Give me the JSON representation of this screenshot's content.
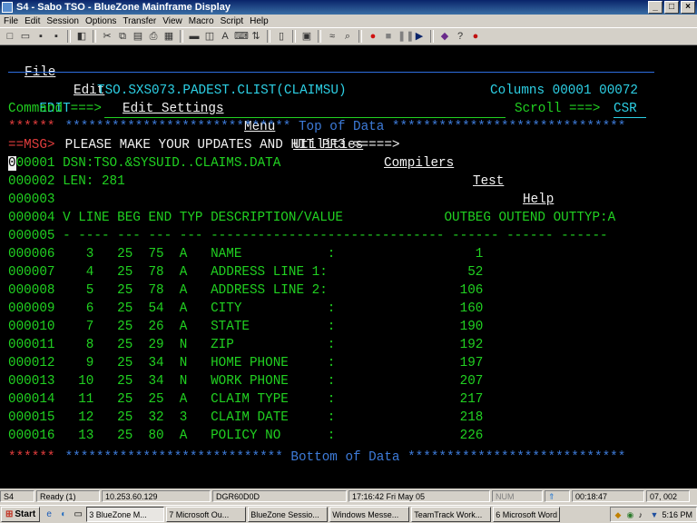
{
  "window": {
    "title": "S4 - Sabo TSO - BlueZone Mainframe Display"
  },
  "menu": [
    "File",
    "Edit",
    "Session",
    "Options",
    "Transfer",
    "View",
    "Macro",
    "Script",
    "Help"
  ],
  "ispf_menu": {
    "file": "File",
    "edit": "Edit",
    "edit_settings": "Edit_Settings",
    "menu": "Menu",
    "utilities": "Utilities",
    "compilers": "Compilers",
    "test": "Test",
    "help": "Help"
  },
  "header": {
    "mode": "EDIT",
    "dataset": "TSO.SXS073.PADEST.CLIST(CLAIMSU)",
    "columns": "Columns 00001 00072",
    "command_label": "Command ===>",
    "scroll_label": "Scroll ===>",
    "scroll_value": "CSR"
  },
  "editor": {
    "top_stars": "******",
    "top_marker": " ***************************** Top of Data ******************************",
    "msg_prefix": "==MSG>",
    "msg_text": " PLEASE MAKE YOUR UPDATES AND HIT PF3 =====>",
    "bottom_stars": "******",
    "bottom_marker": " **************************** Bottom of Data ****************************",
    "cursor_char": "0",
    "rows": [
      {
        "num": "00001",
        "text": " DSN:TSO.&SYSUID..CLAIMS.DATA"
      },
      {
        "num": "000002",
        "text": " LEN: 281"
      },
      {
        "num": "000003",
        "text": ""
      },
      {
        "num": "000004",
        "text": " V LINE BEG END TYP DESCRIPTION/VALUE             OUTBEG OUTEND OUTTYP:A"
      },
      {
        "num": "000005",
        "text": " - ---- --- --- --- ------------------------------ ------ ------ ------"
      },
      {
        "num": "000006",
        "text": "    3   25  75  A   NAME           :                  1"
      },
      {
        "num": "000007",
        "text": "    4   25  78  A   ADDRESS LINE 1:                  52"
      },
      {
        "num": "000008",
        "text": "    5   25  78  A   ADDRESS LINE 2:                 106"
      },
      {
        "num": "000009",
        "text": "    6   25  54  A   CITY           :                160"
      },
      {
        "num": "000010",
        "text": "    7   25  26  A   STATE          :                190"
      },
      {
        "num": "000011",
        "text": "    8   25  29  N   ZIP            :                192"
      },
      {
        "num": "000012",
        "text": "    9   25  34  N   HOME PHONE     :                197"
      },
      {
        "num": "000013",
        "text": "   10   25  34  N   WORK PHONE     :                207"
      },
      {
        "num": "000014",
        "text": "   11   25  25  A   CLAIM TYPE     :                217"
      },
      {
        "num": "000015",
        "text": "   12   25  32  3   CLAIM DATE     :                218"
      },
      {
        "num": "000016",
        "text": "   13   25  80  A   POLICY NO      :                226"
      }
    ]
  },
  "statusbar": {
    "session": "S4",
    "state": "Ready (1)",
    "ip": "10.253.60.129",
    "lu": "DGR60D0D",
    "datetime": "17:16:42  Fri May 05",
    "num": "NUM",
    "elapsed": "00:18:47",
    "pos": "07, 002"
  },
  "taskbar": {
    "start": "Start",
    "tasks": [
      "3 BlueZone M...",
      "7 Microsoft Ou...",
      "BlueZone Sessio...",
      "Windows Messe...",
      "TeamTrack Work...",
      "6 Microsoft Word"
    ],
    "clock": "5:16 PM"
  },
  "colors": {
    "green": "#21d121",
    "cyan": "#2dd0e5",
    "white": "#f2f2f2",
    "red": "#e23d3d",
    "blue": "#3d7bd9"
  }
}
